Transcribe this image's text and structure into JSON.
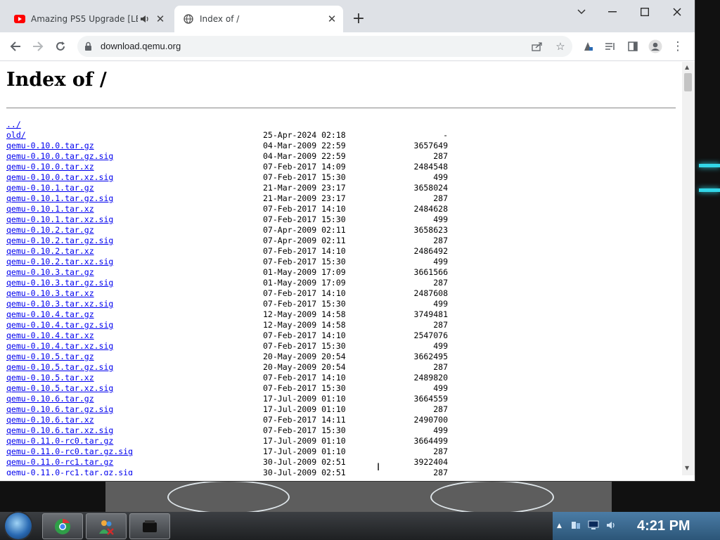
{
  "browser": {
    "tabs": [
      {
        "title": "Amazing PS5 Upgrade [LE",
        "favicon": "youtube-icon",
        "audio": true,
        "active": false
      },
      {
        "title": "Index of /",
        "favicon": "globe-icon",
        "active": true
      }
    ],
    "url": "download.qemu.org"
  },
  "page": {
    "heading": "Index of /",
    "entries": [
      {
        "name": "../",
        "date": "",
        "size": ""
      },
      {
        "name": "old/",
        "date": "25-Apr-2024 02:18",
        "size": "-"
      },
      {
        "name": "qemu-0.10.0.tar.gz",
        "date": "04-Mar-2009 22:59",
        "size": "3657649"
      },
      {
        "name": "qemu-0.10.0.tar.gz.sig",
        "date": "04-Mar-2009 22:59",
        "size": "287"
      },
      {
        "name": "qemu-0.10.0.tar.xz",
        "date": "07-Feb-2017 14:09",
        "size": "2484548"
      },
      {
        "name": "qemu-0.10.0.tar.xz.sig",
        "date": "07-Feb-2017 15:30",
        "size": "499"
      },
      {
        "name": "qemu-0.10.1.tar.gz",
        "date": "21-Mar-2009 23:17",
        "size": "3658024"
      },
      {
        "name": "qemu-0.10.1.tar.gz.sig",
        "date": "21-Mar-2009 23:17",
        "size": "287"
      },
      {
        "name": "qemu-0.10.1.tar.xz",
        "date": "07-Feb-2017 14:10",
        "size": "2484628"
      },
      {
        "name": "qemu-0.10.1.tar.xz.sig",
        "date": "07-Feb-2017 15:30",
        "size": "499"
      },
      {
        "name": "qemu-0.10.2.tar.gz",
        "date": "07-Apr-2009 02:11",
        "size": "3658623"
      },
      {
        "name": "qemu-0.10.2.tar.gz.sig",
        "date": "07-Apr-2009 02:11",
        "size": "287"
      },
      {
        "name": "qemu-0.10.2.tar.xz",
        "date": "07-Feb-2017 14:10",
        "size": "2486492"
      },
      {
        "name": "qemu-0.10.2.tar.xz.sig",
        "date": "07-Feb-2017 15:30",
        "size": "499"
      },
      {
        "name": "qemu-0.10.3.tar.gz",
        "date": "01-May-2009 17:09",
        "size": "3661566"
      },
      {
        "name": "qemu-0.10.3.tar.gz.sig",
        "date": "01-May-2009 17:09",
        "size": "287"
      },
      {
        "name": "qemu-0.10.3.tar.xz",
        "date": "07-Feb-2017 14:10",
        "size": "2487608"
      },
      {
        "name": "qemu-0.10.3.tar.xz.sig",
        "date": "07-Feb-2017 15:30",
        "size": "499"
      },
      {
        "name": "qemu-0.10.4.tar.gz",
        "date": "12-May-2009 14:58",
        "size": "3749481"
      },
      {
        "name": "qemu-0.10.4.tar.gz.sig",
        "date": "12-May-2009 14:58",
        "size": "287"
      },
      {
        "name": "qemu-0.10.4.tar.xz",
        "date": "07-Feb-2017 14:10",
        "size": "2547076"
      },
      {
        "name": "qemu-0.10.4.tar.xz.sig",
        "date": "07-Feb-2017 15:30",
        "size": "499"
      },
      {
        "name": "qemu-0.10.5.tar.gz",
        "date": "20-May-2009 20:54",
        "size": "3662495"
      },
      {
        "name": "qemu-0.10.5.tar.gz.sig",
        "date": "20-May-2009 20:54",
        "size": "287"
      },
      {
        "name": "qemu-0.10.5.tar.xz",
        "date": "07-Feb-2017 14:10",
        "size": "2489820"
      },
      {
        "name": "qemu-0.10.5.tar.xz.sig",
        "date": "07-Feb-2017 15:30",
        "size": "499"
      },
      {
        "name": "qemu-0.10.6.tar.gz",
        "date": "17-Jul-2009 01:10",
        "size": "3664559"
      },
      {
        "name": "qemu-0.10.6.tar.gz.sig",
        "date": "17-Jul-2009 01:10",
        "size": "287"
      },
      {
        "name": "qemu-0.10.6.tar.xz",
        "date": "07-Feb-2017 14:11",
        "size": "2490700"
      },
      {
        "name": "qemu-0.10.6.tar.xz.sig",
        "date": "07-Feb-2017 15:30",
        "size": "499"
      },
      {
        "name": "qemu-0.11.0-rc0.tar.gz",
        "date": "17-Jul-2009 01:10",
        "size": "3664499"
      },
      {
        "name": "qemu-0.11.0-rc0.tar.gz.sig",
        "date": "17-Jul-2009 01:10",
        "size": "287"
      },
      {
        "name": "qemu-0.11.0-rc1.tar.gz",
        "date": "30-Jul-2009 02:51",
        "size": "3922404"
      },
      {
        "name": "qemu-0.11.0-rc1.tar.gz.sig",
        "date": "30-Jul-2009 02:51",
        "size": "287"
      }
    ]
  },
  "taskbar": {
    "items": [
      "chrome-icon",
      "messenger-icon",
      "terminal-icon"
    ],
    "tray_icons": [
      "show-hidden-icon",
      "network-icon",
      "display-icon",
      "volume-icon"
    ],
    "clock": "4:21 PM"
  },
  "colors": {
    "link": "#0000ee",
    "tabstrip": "#dee1e6",
    "taskbar": "#2a2c2f"
  }
}
